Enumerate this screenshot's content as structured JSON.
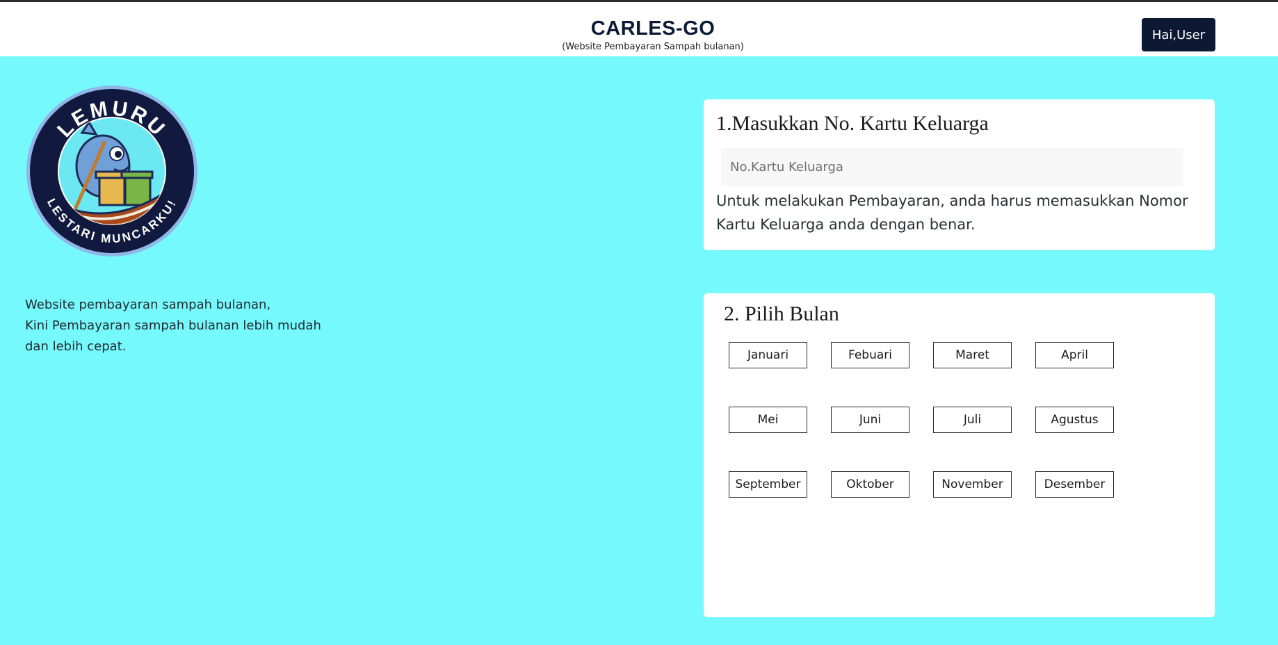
{
  "header": {
    "title": "CARLES-GO",
    "subtitle": "(Website Pembayaran Sampah bulanan)",
    "user_button": "Hai,User"
  },
  "logo": {
    "top_text": "LEMURU",
    "bottom_text": "LESTARI MUNCARKU!",
    "colors": {
      "ring": "#111a3e",
      "inner": "#6be8f2",
      "boat": "#a44a1d",
      "bin_yellow": "#e6b84d",
      "bin_green": "#7ab548",
      "fish": "#6fa0d8"
    }
  },
  "intro": {
    "lines": [
      "Website pembayaran sampah bulanan,",
      "Kini Pembayaran sampah bulanan lebih mudah",
      "dan lebih cepat."
    ]
  },
  "step1": {
    "title": "1.Masukkan No. Kartu Keluarga",
    "input_placeholder": "No.Kartu Keluarga",
    "input_value": "",
    "note": "Untuk melakukan Pembayaran, anda harus memasukkan Nomor Kartu Keluarga anda dengan benar."
  },
  "step2": {
    "title": "2. Pilih Bulan",
    "months": [
      "Januari",
      "Febuari",
      "Maret",
      "April",
      "Mei",
      "Juni",
      "Juli",
      "Agustus",
      "September",
      "Oktober",
      "November",
      "Desember"
    ]
  },
  "colors": {
    "page_background": "#76f9fd",
    "header_background": "#ffffff",
    "brand_text": "#0e1a35",
    "user_button_bg": "#0d1833",
    "card_background": "#ffffff"
  }
}
